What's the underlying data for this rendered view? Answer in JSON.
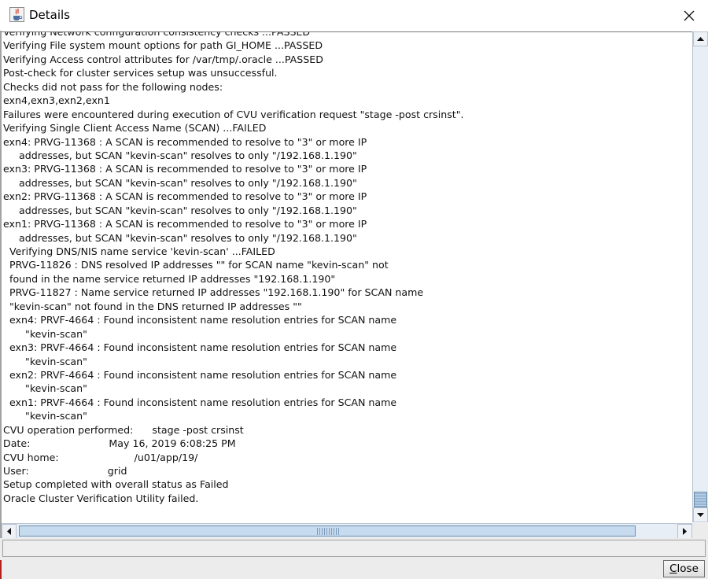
{
  "window": {
    "title": "Details",
    "icon": "java-coffee-cup-icon",
    "close_icon": "close-x-icon"
  },
  "log": {
    "lines": [
      "Verifying Network configuration consistency checks ...PASSED",
      "Verifying File system mount options for path GI_HOME ...PASSED",
      "Verifying Access control attributes for /var/tmp/.oracle ...PASSED",
      "Post-check for cluster services setup was unsuccessful.",
      "Checks did not pass for the following nodes:",
      "exn4,exn3,exn2,exn1",
      "Failures were encountered during execution of CVU verification request \"stage -post crsinst\".",
      "Verifying Single Client Access Name (SCAN) ...FAILED",
      "exn4: PRVG-11368 : A SCAN is recommended to resolve to \"3\" or more IP",
      "     addresses, but SCAN \"kevin-scan\" resolves to only \"/192.168.1.190\"",
      "exn3: PRVG-11368 : A SCAN is recommended to resolve to \"3\" or more IP",
      "     addresses, but SCAN \"kevin-scan\" resolves to only \"/192.168.1.190\"",
      "exn2: PRVG-11368 : A SCAN is recommended to resolve to \"3\" or more IP",
      "     addresses, but SCAN \"kevin-scan\" resolves to only \"/192.168.1.190\"",
      "exn1: PRVG-11368 : A SCAN is recommended to resolve to \"3\" or more IP",
      "     addresses, but SCAN \"kevin-scan\" resolves to only \"/192.168.1.190\"",
      "  Verifying DNS/NIS name service 'kevin-scan' ...FAILED",
      "  PRVG-11826 : DNS resolved IP addresses \"\" for SCAN name \"kevin-scan\" not",
      "  found in the name service returned IP addresses \"192.168.1.190\"",
      "  PRVG-11827 : Name service returned IP addresses \"192.168.1.190\" for SCAN name",
      "  \"kevin-scan\" not found in the DNS returned IP addresses \"\"",
      "  exn4: PRVF-4664 : Found inconsistent name resolution entries for SCAN name",
      "       \"kevin-scan\"",
      "  exn3: PRVF-4664 : Found inconsistent name resolution entries for SCAN name",
      "       \"kevin-scan\"",
      "  exn2: PRVF-4664 : Found inconsistent name resolution entries for SCAN name",
      "       \"kevin-scan\"",
      "  exn1: PRVF-4664 : Found inconsistent name resolution entries for SCAN name",
      "       \"kevin-scan\"",
      "CVU operation performed:      stage -post crsinst",
      "Date:                         May 16, 2019 6:08:25 PM",
      "CVU home:                        /u01/app/19/",
      "User:                         grid",
      "Setup completed with overall status as Failed",
      "Oracle Cluster Verification Utility failed."
    ]
  },
  "scroll": {
    "vertical_position": 1.0,
    "horizontal_position": 0.0
  },
  "footer": {
    "close_label_mnemonic": "C",
    "close_label_rest": "lose"
  }
}
